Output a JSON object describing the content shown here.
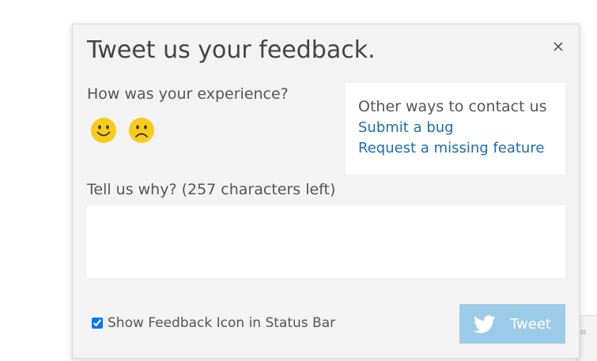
{
  "dialog": {
    "title": "Tweet us your feedback.",
    "close_icon": "close-icon",
    "experience": {
      "question": "How was your experience?",
      "happy_icon": "smiley-happy-icon",
      "sad_icon": "smiley-sad-icon",
      "face_color": "#f9cb1b"
    },
    "contact": {
      "heading": "Other ways to contact us",
      "links": [
        {
          "label": "Submit a bug"
        },
        {
          "label": "Request a missing feature"
        }
      ],
      "link_color": "#1e6cb0"
    },
    "why": {
      "label": "Tell us why?",
      "counter": "(257 characters left)",
      "value": "",
      "placeholder": ""
    },
    "show_icon": {
      "label": "Show Feedback Icon in Status Bar",
      "checked": true
    },
    "tweet": {
      "label": "Tweet",
      "icon": "twitter-bird-icon",
      "color": "#9ccbe8"
    }
  }
}
